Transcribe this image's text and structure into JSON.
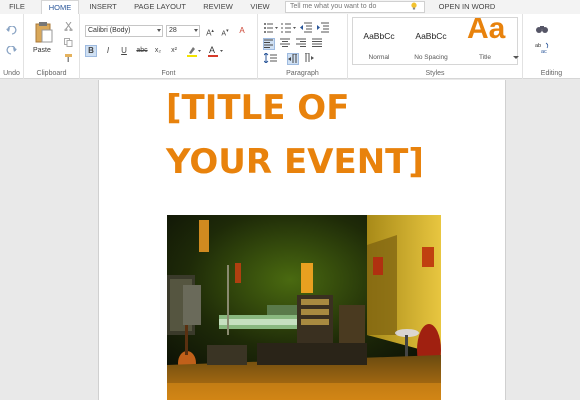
{
  "tabs": [
    {
      "label": "FILE",
      "active": false
    },
    {
      "label": "HOME",
      "active": true
    },
    {
      "label": "INSERT",
      "active": false
    },
    {
      "label": "PAGE LAYOUT",
      "active": false
    },
    {
      "label": "REVIEW",
      "active": false
    },
    {
      "label": "VIEW",
      "active": false
    }
  ],
  "tell_me": {
    "placeholder": "Tell me what you want to do",
    "icon": "lightbulb-icon"
  },
  "open_in_word": "OPEN IN WORD",
  "groups": {
    "undo": "Undo",
    "clipboard": "Clipboard",
    "font": "Font",
    "paragraph": "Paragraph",
    "styles": "Styles",
    "editing": "Editing"
  },
  "clipboard": {
    "paste_label": "Paste"
  },
  "font": {
    "name": "Calibri (Body)",
    "size": "28",
    "buttons": [
      "B",
      "I",
      "U",
      "abc",
      "x₂",
      "x²"
    ]
  },
  "styles": [
    {
      "preview": "AaBbCc",
      "name": "Normal"
    },
    {
      "preview": "AaBbCc",
      "name": "No Spacing"
    },
    {
      "preview": "Aa",
      "name": "Title"
    }
  ],
  "document": {
    "title_line_1": "[TITLE OF",
    "title_line_2": "YOUR EVENT]",
    "image_alt": "concert stage with instruments"
  },
  "colors": {
    "accent": "#2b579a",
    "title_orange": "#e8820c"
  }
}
